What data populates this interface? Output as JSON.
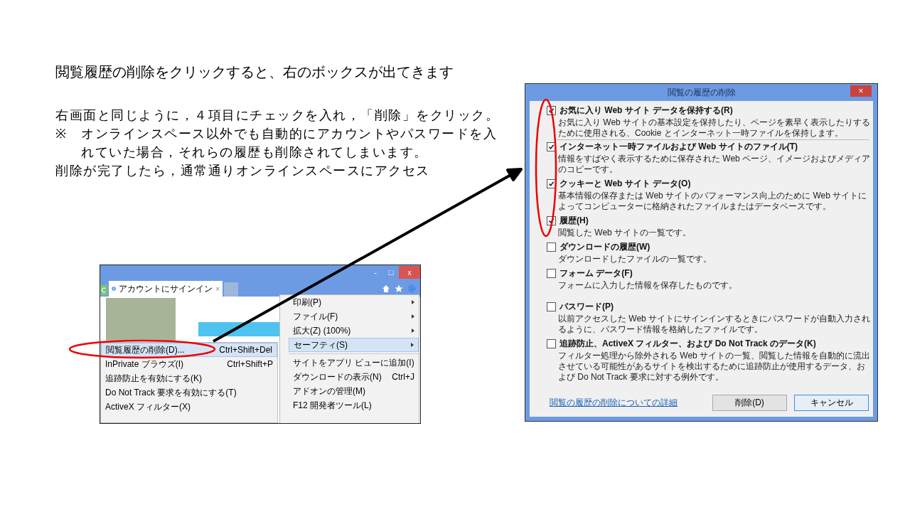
{
  "slide": {
    "heading": "閲覧履歴の削除をクリックすると、右のボックスが出てきます",
    "paragraphs": [
      {
        "kind": "plain",
        "text": "右画面と同じように，４項目にチェックを入れ，「削除」をクリック。"
      },
      {
        "kind": "note",
        "mark": "※",
        "text": "オンラインスペース以外でも自動的にアカウントやパスワードを入れていた場合，それらの履歴も削除されてしまいます。"
      },
      {
        "kind": "plain",
        "text": "削除が完了したら，通常通りオンラインスペースにアクセス"
      }
    ]
  },
  "browser": {
    "tab": {
      "title": "アカウントにサインイン",
      "close": "×"
    },
    "window_buttons": [
      "-",
      "□",
      "x"
    ],
    "safety_menu": [
      {
        "label": "閲覧履歴の削除(D)...",
        "shortcut": "Ctrl+Shift+Del",
        "selected": true
      },
      {
        "label": "InPrivate ブラウズ(I)",
        "shortcut": "Ctrl+Shift+P",
        "selected": false
      },
      {
        "label": "追跡防止を有効にする(K)",
        "selected": false
      },
      {
        "label": "Do Not Track 要求を有効にする(T)",
        "selected": false
      },
      {
        "label": "ActiveX フィルター(X)",
        "selected": false
      }
    ],
    "tools_menu": [
      {
        "label": "印刷(P)",
        "submenu": true,
        "selected": false
      },
      {
        "label": "ファイル(F)",
        "submenu": true,
        "selected": false
      },
      {
        "label": "拡大(Z) (100%)",
        "submenu": true,
        "selected": false
      },
      {
        "label": "セーフティ(S)",
        "submenu": true,
        "selected": true
      },
      {
        "label": "サイトをアプリ ビューに追加(I)",
        "submenu": false,
        "selected": false,
        "separator_before": true
      },
      {
        "label": "ダウンロードの表示(N)",
        "shortcut": "Ctrl+J",
        "submenu": false,
        "selected": false
      },
      {
        "label": "アドオンの管理(M)",
        "submenu": false,
        "selected": false
      },
      {
        "label": "F12 開発者ツール(L)",
        "submenu": false,
        "selected": false
      }
    ]
  },
  "dialog": {
    "title": "閲覧の履歴の削除",
    "close": "×",
    "options": [
      {
        "label": "お気に入り Web サイト データを保持する(R)",
        "description": "お気に入り Web サイトの基本設定を保持したり、ページを素早く表示したりするために使用される、Cookie とインターネット一時ファイルを保持します。",
        "checked": true,
        "separator_after": true
      },
      {
        "label": "インターネット一時ファイルおよび Web サイトのファイル(T)",
        "description": "情報をすばやく表示するために保存された Web ページ、イメージおよびメディアのコピーです。",
        "checked": true
      },
      {
        "label": "クッキーと Web サイト データ(O)",
        "description": "基本情報の保存または Web サイトのパフォーマンス向上のために Web サイトによってコンピューターに格納されたファイルまたはデータベースです。",
        "checked": true
      },
      {
        "label": "履歴(H)",
        "description": "閲覧した Web サイトの一覧です。",
        "checked": true
      },
      {
        "label": "ダウンロードの履歴(W)",
        "description": "ダウンロードしたファイルの一覧です。",
        "checked": false
      },
      {
        "label": "フォーム データ(F)",
        "description": "フォームに入力した情報を保存したものです。",
        "checked": false
      },
      {
        "label": "パスワード(P)",
        "description": "以前アクセスした Web サイトにサインインするときにパスワードが自動入力されるように、パスワード情報を格納したファイルです。",
        "checked": false
      },
      {
        "label": "追跡防止、ActiveX フィルター、および Do Not Track のデータ(K)",
        "description": "フィルター処理から除外される Web サイトの一覧、閲覧した情報を自動的に流出させている可能性があるサイトを検出するために追跡防止が使用するデータ、および Do Not Track 要求に対する例外です。",
        "checked": false
      }
    ],
    "link": "閲覧の履歴の削除についての詳細",
    "buttons": [
      "削除(D)",
      "キャンセル"
    ]
  }
}
